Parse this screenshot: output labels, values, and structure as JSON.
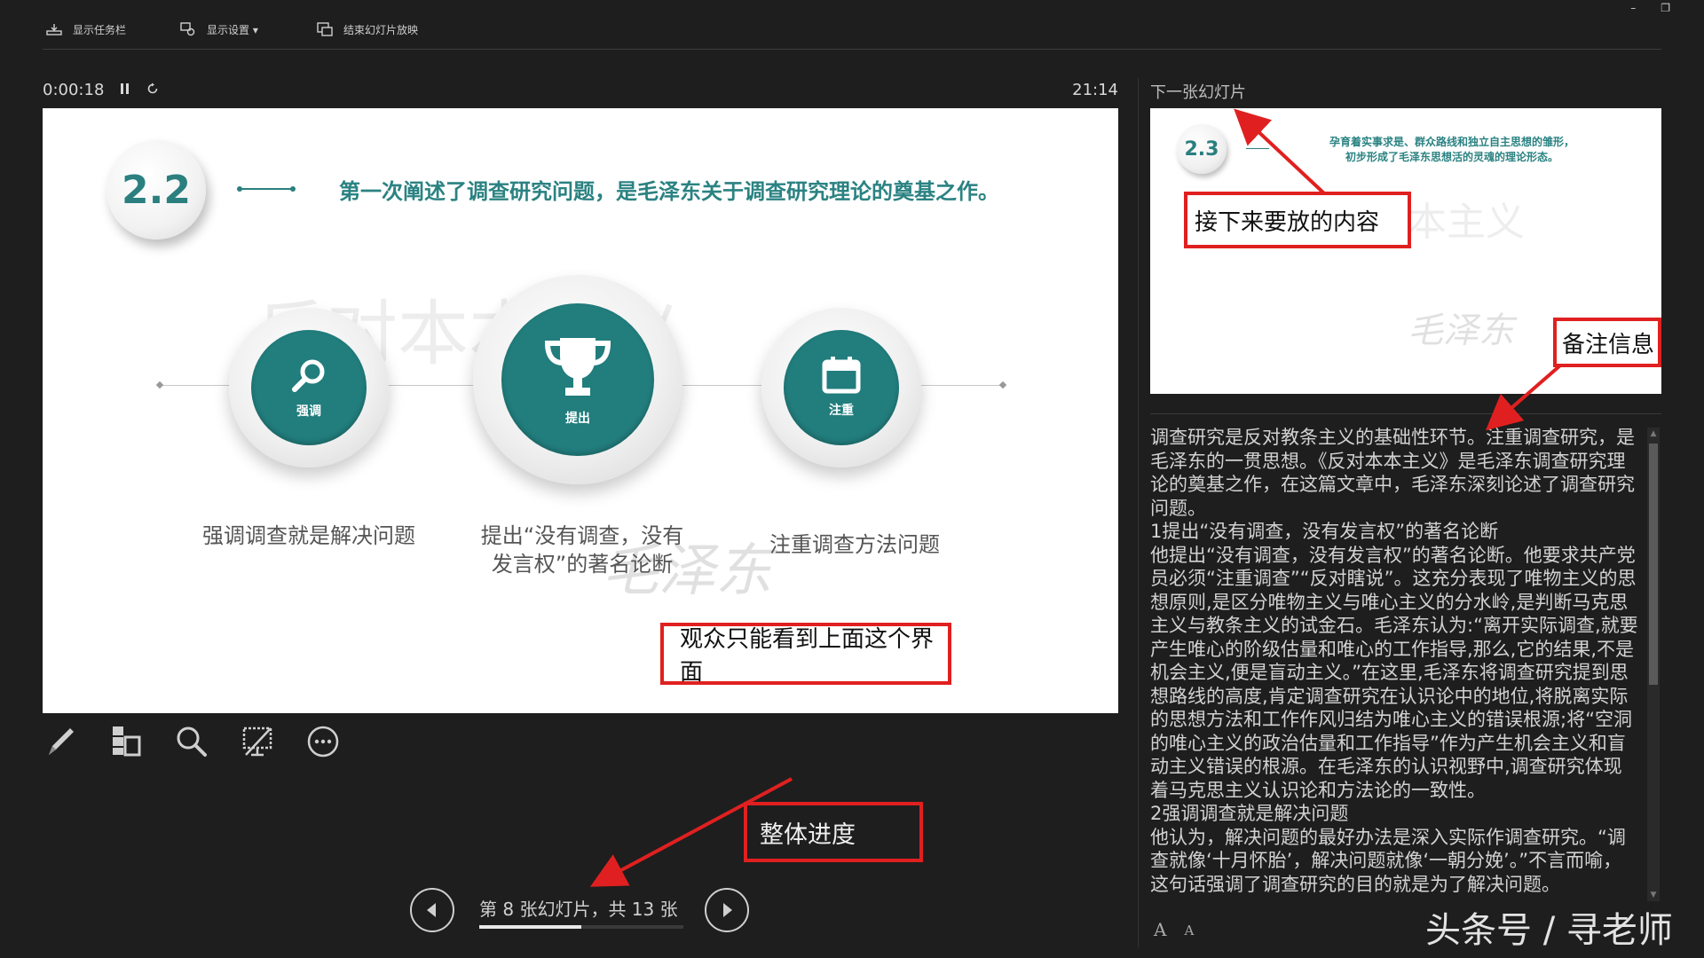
{
  "toolbar": {
    "show_taskbar": "显示任务栏",
    "display_settings": "显示设置 ▾",
    "end_slideshow": "结束幻灯片放映",
    "minimize": "–",
    "restore": "❐"
  },
  "presenter": {
    "elapsed_time": "0:00:18",
    "pause_icon": "pause-icon",
    "restart_icon": "restart-icon",
    "clock": "21:14",
    "next_slide_label": "下一张幻灯片"
  },
  "current_slide": {
    "section_number": "2.2",
    "heading": "第一次阐述了调查研究问题，是毛泽东关于调查研究理论的奠基之作。",
    "watermark": "反对本本主义",
    "signature": "毛泽东",
    "items": [
      {
        "icon": "search-icon",
        "label": "强调",
        "caption": "强调调查就是解决问题"
      },
      {
        "icon": "trophy-icon",
        "label": "提出",
        "caption": "提出“没有调查，没有\n发言权”的著名论断"
      },
      {
        "icon": "calendar-icon",
        "label": "注重",
        "caption": "注重调查方法问题"
      }
    ]
  },
  "tools": [
    "pen-icon",
    "slides-grid-icon",
    "zoom-icon",
    "black-screen-icon",
    "more-options-icon"
  ],
  "navigation": {
    "slide_counter": "第 8 张幻灯片，共 13 张",
    "progress": 0.5
  },
  "next_slide": {
    "section_number": "2.3",
    "text": "孕育着实事求是、群众路线和独立自主思想的雏形，\n初步形成了毛泽东思想活的灵魂的理论形态。",
    "watermark": "本主义",
    "signature": "毛泽东"
  },
  "notes": "调查研究是反对教条主义的基础性环节。注重调查研究，是毛泽东的一贯思想。《反对本本主义》是毛泽东调查研究理论的奠基之作，在这篇文章中，毛泽东深刻论述了调查研究问题。\n1提出“没有调查，没有发言权”的著名论断\n他提出“没有调查，没有发言权”的著名论断。他要求共产党员必须“注重调查”“反对瞎说”。这充分表现了唯物主义的思想原则,是区分唯物主义与唯心主义的分水岭,是判断马克思主义与教条主义的试金石。毛泽东认为:“离开实际调查,就要产生唯心的阶级估量和唯心的工作指导,那么,它的结果,不是机会主义,便是盲动主义。”在这里,毛泽东将调查研究提到思想路线的高度,肯定调查研究在认识论中的地位,将脱离实际的思想方法和工作作风归结为唯心主义的错误根源;将“空洞的唯心主义的政治估量和工作指导”作为产生机会主义和盲动主义错误的根源。在毛泽东的认识视野中,调查研究体现着马克思主义认识论和方法论的一致性。\n2强调调查就是解决问题\n他认为，解决问题的最好办法是深入实际作调查研究。“调查就像‘十月怀胎’，解决问题就像‘一朝分娩’。”不言而喻，这句话强调了调查研究的目的就是为了解决问题。",
  "font_controls": {
    "increase": "A",
    "decrease": "A"
  },
  "annotations": {
    "audience_view": "观众只能看到上面这个界面",
    "next_content": "接下来要放的内容",
    "notes_info": "备注信息",
    "overall_progress": "整体进度"
  },
  "site_watermark": "头条号 / 寻老师",
  "colors": {
    "background": "#1e1e1e",
    "accent_teal": "#227d7d",
    "annotation_red": "#e02020"
  }
}
